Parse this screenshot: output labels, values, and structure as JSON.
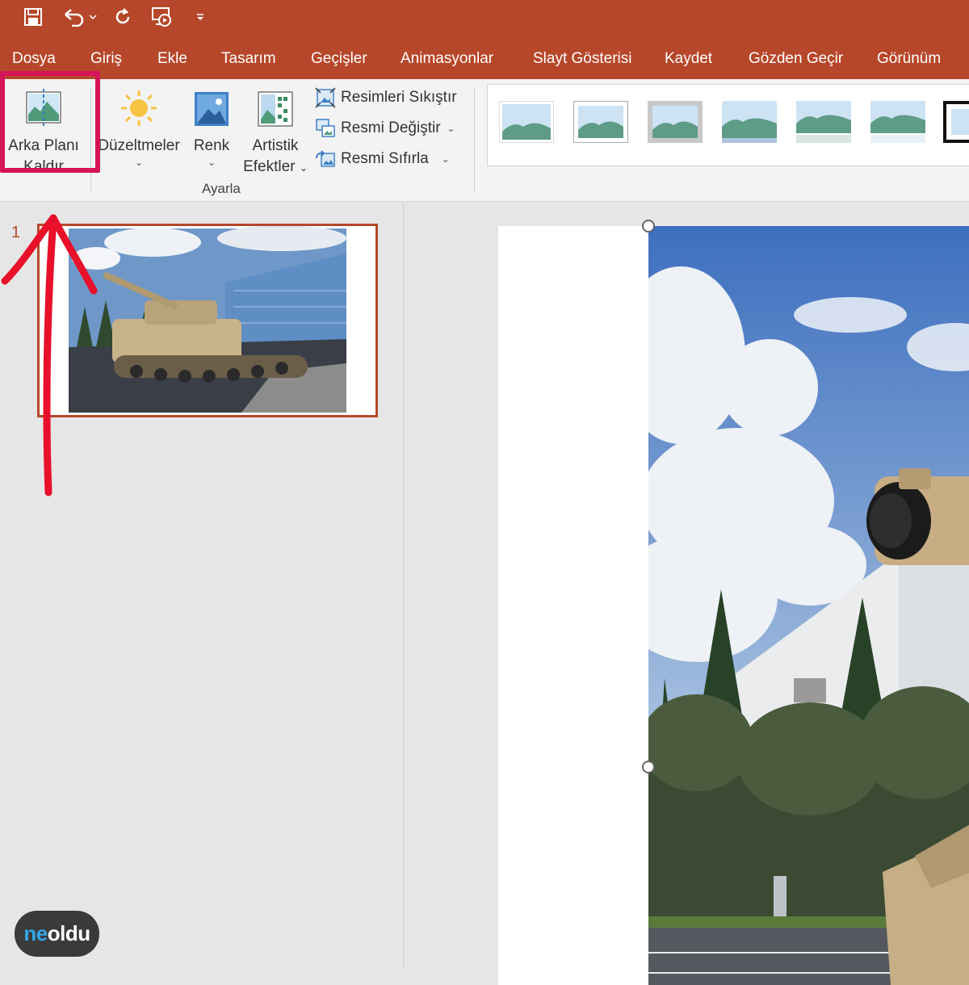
{
  "quick_access": {
    "save": "save-icon",
    "undo": "undo-icon",
    "redo": "redo-icon",
    "present": "present-icon",
    "customize": "customize-icon"
  },
  "tabs": [
    {
      "label": "Dosya"
    },
    {
      "label": "Giriş"
    },
    {
      "label": "Ekle"
    },
    {
      "label": "Tasarım"
    },
    {
      "label": "Geçişler"
    },
    {
      "label": "Animasyonlar"
    },
    {
      "label": "Slayt Gösterisi"
    },
    {
      "label": "Kaydet"
    },
    {
      "label": "Gözden Geçir"
    },
    {
      "label": "Görünüm"
    }
  ],
  "ribbon": {
    "remove_bg_line1": "Arka Planı",
    "remove_bg_line2": "Kaldır",
    "corrections": "Düzeltmeler",
    "color": "Renk",
    "artistic_line1": "Artistik",
    "artistic_line2": "Efektler",
    "compress": "Resimleri Sıkıştır",
    "change": "Resmi Değiştir",
    "reset": "Resmi Sıfırla",
    "group_label": "Ayarla"
  },
  "slides": {
    "number": "1"
  },
  "logo": {
    "part1": "ne",
    "part2": "oldu"
  },
  "colors": {
    "accent": "#b7472a",
    "highlight": "#d6145a",
    "arrow": "#e8102a"
  }
}
